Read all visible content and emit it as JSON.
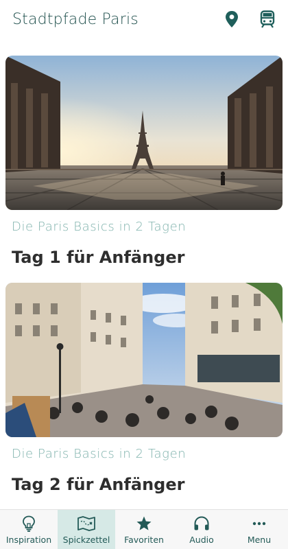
{
  "header": {
    "title": "Stadtpfade Paris",
    "icons": [
      "map-pin-icon",
      "train-icon"
    ]
  },
  "cards": [
    {
      "subtitle": "Die Paris Basics in 2 Tagen",
      "title": "Tag 1 für Anfänger",
      "image": "eiffel-tower-trocadero-photo"
    },
    {
      "subtitle": "Die Paris Basics in 2 Tagen",
      "title": "Tag 2 für Anfänger",
      "image": "montmartre-street-photo"
    }
  ],
  "nav": {
    "items": [
      {
        "label": "Inspiration",
        "icon": "lightbulb-icon"
      },
      {
        "label": "Spickzettel",
        "icon": "map-icon",
        "active": true
      },
      {
        "label": "Favoriten",
        "icon": "star-icon"
      },
      {
        "label": "Audio",
        "icon": "headphones-icon"
      },
      {
        "label": "Menu",
        "icon": "more-icon"
      }
    ]
  },
  "colors": {
    "accent": "#1f5f5b",
    "subtitle": "#7fb2ac",
    "active_tab": "#d6e9e6"
  }
}
